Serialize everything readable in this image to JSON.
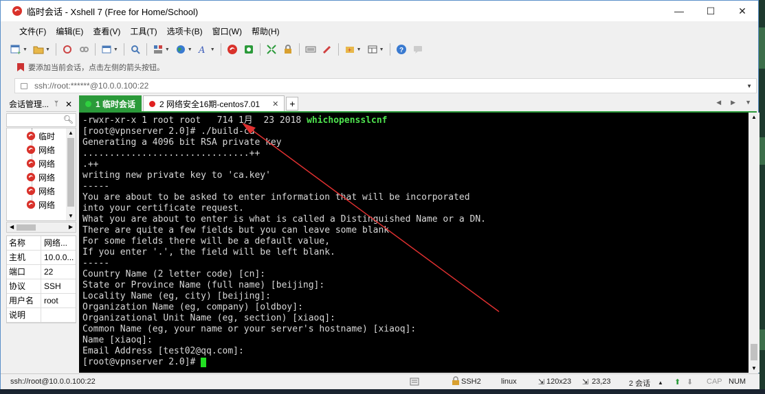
{
  "window": {
    "title": "临时会话 - Xshell 7 (Free for Home/School)",
    "controls": {
      "minimize": "—",
      "maximize": "☐",
      "close": "✕"
    }
  },
  "menu": [
    "文件(F)",
    "编辑(E)",
    "查看(V)",
    "工具(T)",
    "选项卡(B)",
    "窗口(W)",
    "帮助(H)"
  ],
  "hint": "要添加当前会话，点击左侧的箭头按钮。",
  "address": {
    "value": "ssh://root:******@10.0.0.100:22"
  },
  "panel": {
    "title": "会话管理...",
    "pin": "ᛘ",
    "close": "✕",
    "tree_items": [
      "临时",
      "网络",
      "网络",
      "网络",
      "网络",
      "网络"
    ],
    "props": [
      {
        "k": "名称",
        "v": "网络..."
      },
      {
        "k": "主机",
        "v": "10.0.0..."
      },
      {
        "k": "端口",
        "v": "22"
      },
      {
        "k": "协议",
        "v": "SSH"
      },
      {
        "k": "用户名",
        "v": "root"
      },
      {
        "k": "说明",
        "v": ""
      }
    ]
  },
  "tabs": [
    {
      "label": "1 临时会话",
      "dot": "#2b9a3a",
      "active": true
    },
    {
      "label": "2 网络安全16期-centos7.01",
      "dot": "#e02020",
      "active": false
    }
  ],
  "tab_add": "+",
  "terminal": {
    "lines": [
      "-rwxr-xr-x 1 root root   714 1月  23 2018 ",
      "[root@vpnserver 2.0]# ./build-ca",
      "Generating a 4096 bit RSA private key",
      "...............................++",
      ".++",
      "writing new private key to 'ca.key'",
      "-----",
      "You are about to be asked to enter information that will be incorporated",
      "into your certificate request.",
      "What you are about to enter is what is called a Distinguished Name or a DN.",
      "There are quite a few fields but you can leave some blank",
      "For some fields there will be a default value,",
      "If you enter '.', the field will be left blank.",
      "-----",
      "Country Name (2 letter code) [cn]:",
      "State or Province Name (full name) [beijing]:",
      "Locality Name (eg, city) [beijing]:",
      "Organization Name (eg, company) [oldboy]:",
      "Organizational Unit Name (eg, section) [xiaoq]:",
      "Common Name (eg, your name or your server's hostname) [xiaoq]:",
      "Name [xiaoq]:",
      "Email Address [test02@qq.com]:",
      "[root@vpnserver 2.0]# "
    ],
    "highlight": "whichopensslcnf"
  },
  "status": {
    "connection": "ssh://root@10.0.0.100:22",
    "protocol": "SSH2",
    "os": "linux",
    "size": "120x23",
    "position": "23,23",
    "sessions": "2 会话",
    "cap": "CAP",
    "num": "NUM"
  },
  "colors": {
    "tab_active": "#2b9a3a",
    "arrow": "#e03030",
    "cursor": "#22e022"
  }
}
